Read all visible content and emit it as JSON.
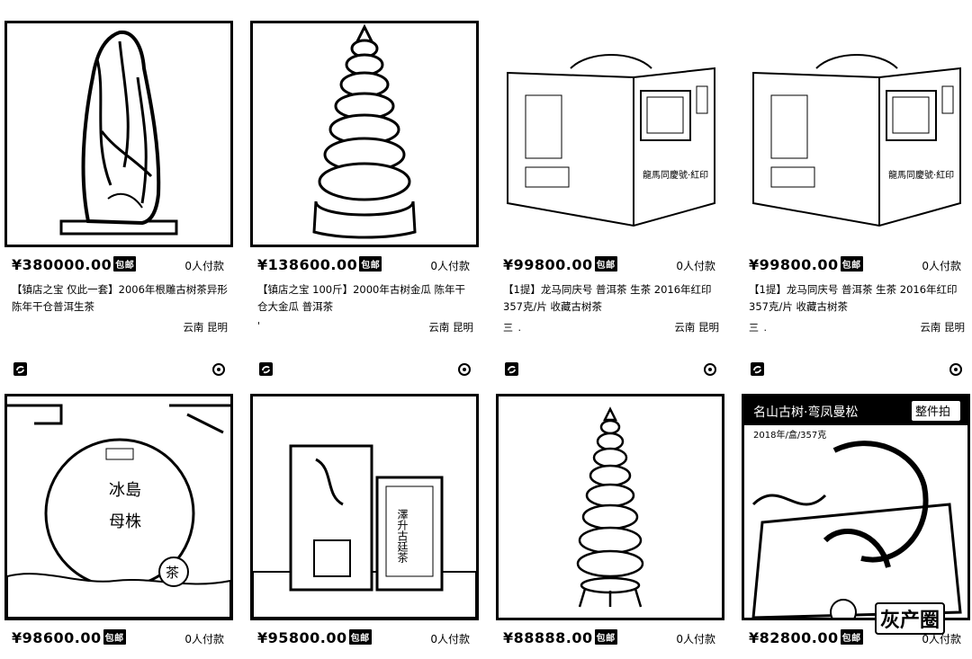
{
  "items": [
    {
      "price": "¥380000.00",
      "badge": "包邮",
      "paid": "0人付款",
      "title": "【镇店之宝 仅此一套】2006年根雕古树茶异形陈年干仓普洱生茶",
      "tags": "",
      "location": "云南 昆明",
      "image": "root-carving"
    },
    {
      "price": "¥138600.00",
      "badge": "包邮",
      "paid": "0人付款",
      "title": "【镇店之宝 100斤】2000年古树金瓜 陈年干仓大金瓜 普洱茶",
      "tags": "'",
      "location": "云南 昆明",
      "image": "tea-pagoda"
    },
    {
      "price": "¥99800.00",
      "badge": "包邮",
      "paid": "0人付款",
      "title": "【1提】龙马同庆号 普洱茶 生茶 2016年红印 357克/片 收藏古树茶",
      "tags": "三 .",
      "location": "云南 昆明",
      "image": "gift-box"
    },
    {
      "price": "¥99800.00",
      "badge": "包邮",
      "paid": "0人付款",
      "title": "【1提】龙马同庆号 普洱茶 生茶 2016年红印 357克/片 收藏古树茶",
      "tags": "三 .",
      "location": "云南 昆明",
      "image": "gift-box"
    },
    {
      "price": "¥98600.00",
      "badge": "包邮",
      "paid": "0人付款",
      "title": "",
      "tags": "",
      "location": "",
      "image": "tea-cake",
      "image_text": [
        "冰島母株",
        "茶"
      ]
    },
    {
      "price": "¥95800.00",
      "badge": "包邮",
      "paid": "0人付款",
      "title": "",
      "tags": "",
      "location": "",
      "image": "tea-boxes",
      "image_text": [
        "澤升古廷茶"
      ]
    },
    {
      "price": "¥88888.00",
      "badge": "包邮",
      "paid": "0人付款",
      "title": "",
      "tags": "",
      "location": "",
      "image": "tea-pagoda-small"
    },
    {
      "price": "¥82800.00",
      "badge": "包邮",
      "paid": "0人付款",
      "title": "",
      "tags": "",
      "location": "",
      "image": "premium-pack",
      "image_text": [
        "名山古树·弯凤曼松",
        "整件拍",
        "2018年/盒/357克"
      ]
    }
  ],
  "box_label": "龍馬同慶號·紅印",
  "watermark": "灰产圈"
}
